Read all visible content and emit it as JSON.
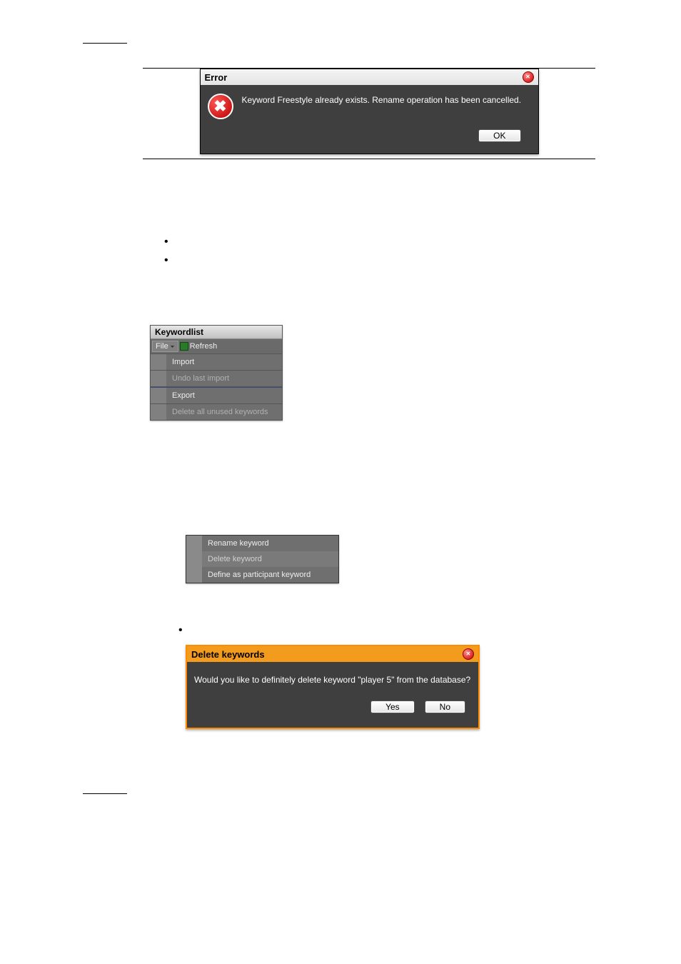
{
  "error_dialog": {
    "title": "Error",
    "message": "Keyword Freestyle already exists. Rename operation has been cancelled.",
    "ok": "OK"
  },
  "keywordlist": {
    "title": "Keywordlist",
    "file_menu": "File",
    "refresh": "Refresh",
    "items": {
      "import": "Import",
      "undo": "Undo last import",
      "export": "Export",
      "delete_unused": "Delete all unused keywords"
    }
  },
  "context_menu": {
    "rename": "Rename keyword",
    "delete": "Delete keyword",
    "define": "Define as participant keyword"
  },
  "delete_dialog": {
    "title": "Delete keywords",
    "message": "Would you like to definitely delete keyword \"player 5\" from the database?",
    "yes": "Yes",
    "no": "No"
  }
}
